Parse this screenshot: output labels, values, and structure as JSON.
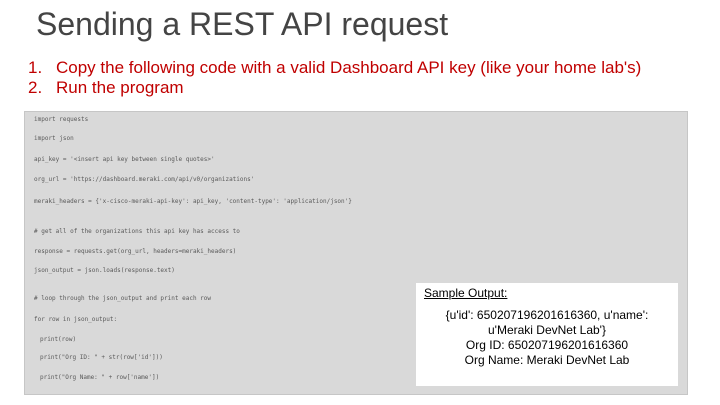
{
  "title": "Sending a REST API request",
  "steps": [
    {
      "num": "1.",
      "text": "Copy the following code with a valid Dashboard API key (like your home lab's)"
    },
    {
      "num": "2.",
      "text": "Run the program"
    }
  ],
  "code": {
    "lines": [
      "import requests",
      "import json",
      "api_key = '<insert api key between single quotes>'",
      "org_url = 'https://dashboard.meraki.com/api/v0/organizations'",
      "meraki_headers = {'x-cisco-meraki-api-key': api_key, 'content-type': 'application/json'}",
      "# get all of the organizations this api key has access to",
      "response = requests.get(org_url, headers=meraki_headers)",
      "json_output = json.loads(response.text)",
      "# loop through the json_output and print each row",
      "for row in json_output:",
      "print(row)",
      "print(\"Org ID: \" + str(row['id']))",
      "print(\"Org Name: \" + row['name'])"
    ]
  },
  "output": {
    "heading": "Sample Output:",
    "lines": [
      "{u'id': 650207196201616360, u'name':",
      "u'Meraki DevNet Lab'}",
      "Org ID: 650207196201616360",
      "Org Name: Meraki DevNet Lab"
    ]
  },
  "colors": {
    "title": "#444444",
    "steps": "#c00000",
    "code_background": "#d9d9d9",
    "code_text": "#595959"
  }
}
